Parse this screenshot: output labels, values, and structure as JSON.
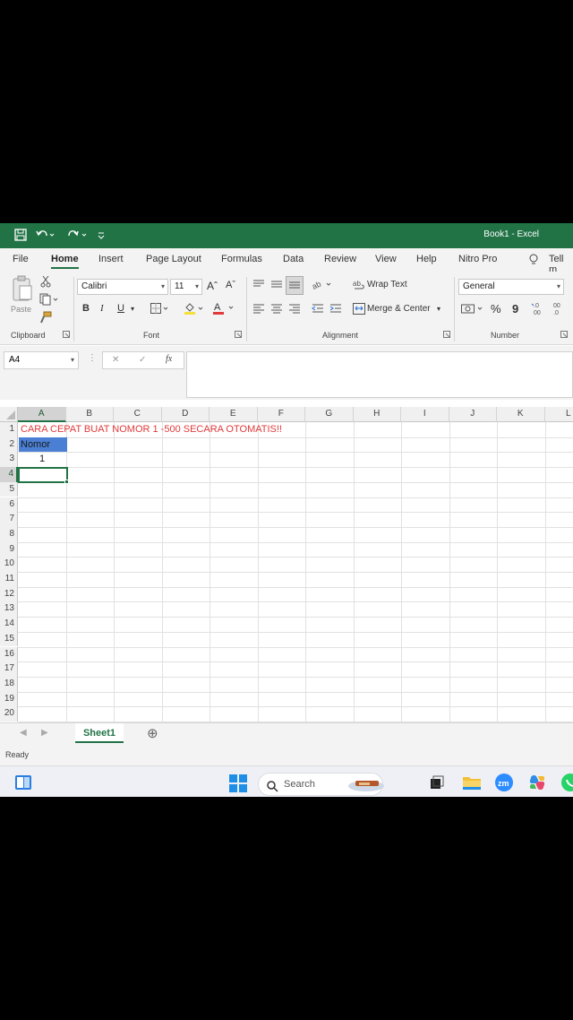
{
  "titlebar": {
    "title": "Book1  -  Excel",
    "bg": "#217346"
  },
  "tabs": [
    "File",
    "Home",
    "Insert",
    "Page Layout",
    "Formulas",
    "Data",
    "Review",
    "View",
    "Help",
    "Nitro Pro",
    "Tell m"
  ],
  "ribbon": {
    "paste_label": "Paste",
    "font_name": "Calibri",
    "font_size": "11",
    "wrap_text": "Wrap Text",
    "merge_center": "Merge & Center",
    "number_format": "General",
    "groups": [
      "Clipboard",
      "Font",
      "Alignment",
      "Number"
    ],
    "bold": "B",
    "italic": "I",
    "underline": "U",
    "grow_font": "Aˆ",
    "shrink_font": "Aˇ",
    "percent": "%",
    "comma": "9"
  },
  "formula_bar": {
    "name_box": "A4",
    "cancel": "✕",
    "enter": "✓",
    "fx": "fx"
  },
  "grid": {
    "columns": [
      "A",
      "B",
      "C",
      "D",
      "E",
      "F",
      "G",
      "H",
      "I",
      "J",
      "K",
      "L"
    ],
    "rows": [
      "1",
      "2",
      "3",
      "4",
      "5",
      "6",
      "7",
      "8",
      "9",
      "10",
      "11",
      "12",
      "13",
      "14",
      "15",
      "16",
      "17",
      "18",
      "19",
      "20"
    ],
    "selected_col": "A",
    "selected_row": "4",
    "cells": {
      "a1": "CARA CEPAT BUAT NOMOR 1 -500 SECARA OTOMATIS!!",
      "a2": "Nomor",
      "a3": "1"
    },
    "a1_color": "#e03a3a",
    "a2_fill": "#4a7fd4"
  },
  "sheets": {
    "add": "⊕",
    "tab": "Sheet1"
  },
  "status": "Ready",
  "taskbar": {
    "search_placeholder": "Search"
  }
}
